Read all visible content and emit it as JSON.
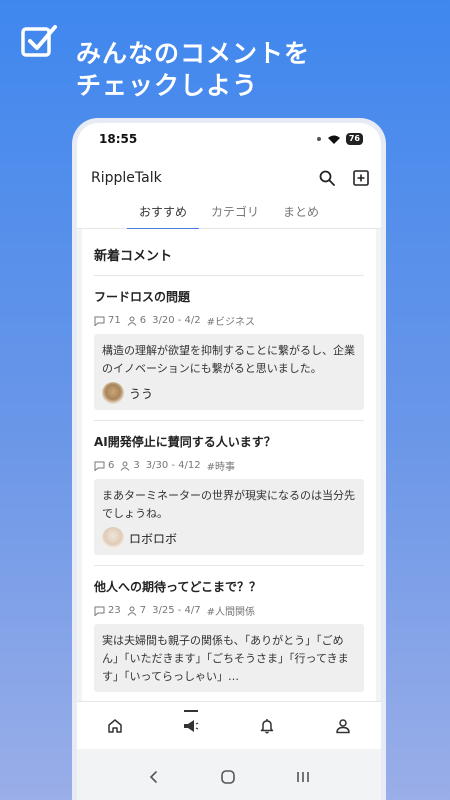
{
  "promo": {
    "line1": "みんなのコメントを",
    "line2": "チェックしよう"
  },
  "status": {
    "time": "18:55",
    "battery": "76"
  },
  "app": {
    "title": "RippleTalk"
  },
  "tabs": [
    {
      "label": "おすすめ"
    },
    {
      "label": "カテゴリ"
    },
    {
      "label": "まとめ"
    }
  ],
  "section_title": "新着コメント",
  "posts": [
    {
      "title": "フードロスの問題",
      "comments": "71",
      "users": "6",
      "dates": "3/20 - 4/2",
      "tag": "#ビジネス",
      "text": "構造の理解が欲望を抑制することに繋がるし、企業のイノベーションにも繋がると思いました。",
      "author": "うう"
    },
    {
      "title": "AI開発停止に賛同する人います？",
      "comments": "6",
      "users": "3",
      "dates": "3/30 - 4/12",
      "tag": "#時事",
      "text": "まあターミネーターの世界が現実になるのは当分先でしょうね。",
      "author": "ロボロボ"
    },
    {
      "title": "他人への期待ってどこまで？？",
      "comments": "23",
      "users": "7",
      "dates": "3/25 - 4/7",
      "tag": "#人間関係",
      "text": "実は夫婦間も親子の関係も、「ありがとう」「ごめん」「いただきます」「ごちそうさま」「行ってきます」「いってらっしゃい」…"
    }
  ],
  "icons": {
    "check": "checkbox-icon",
    "search": "search-icon",
    "add": "add-square-icon",
    "home": "home-icon",
    "megaphone": "megaphone-icon",
    "bell": "bell-icon",
    "profile": "person-icon"
  },
  "colors": {
    "accent": "#4a7fe0",
    "background": "#3f87ee"
  }
}
